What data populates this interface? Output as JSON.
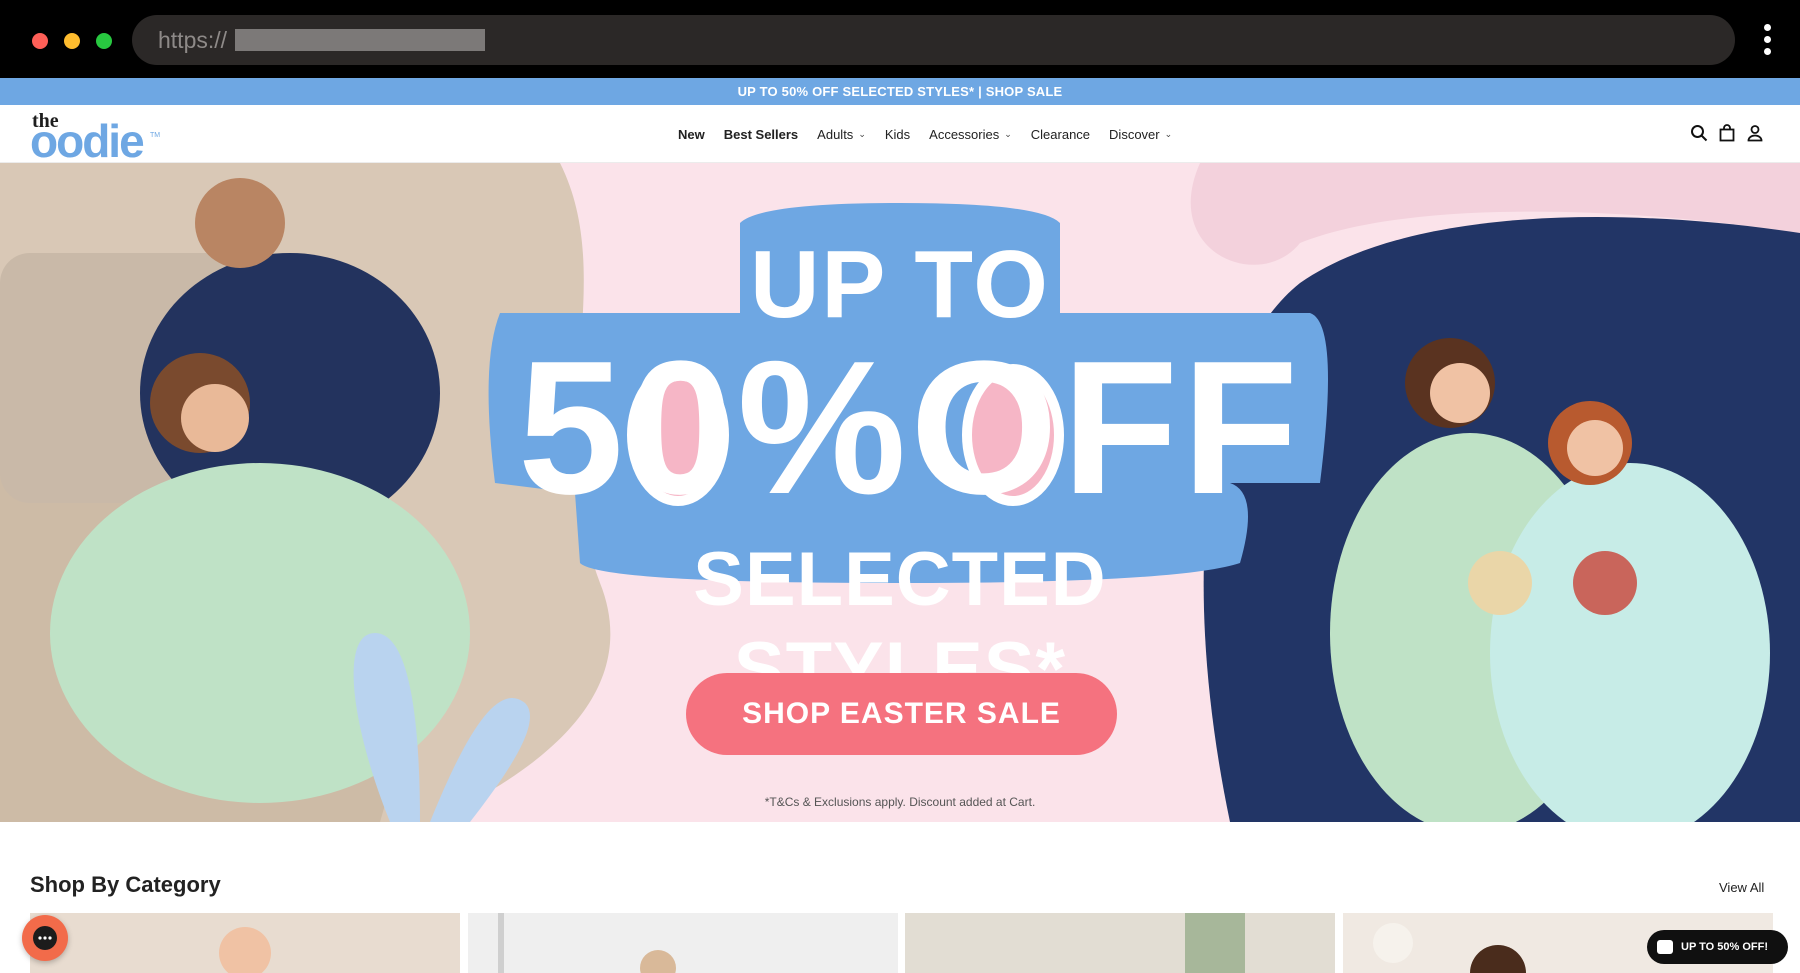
{
  "browser": {
    "url_protocol": "https://"
  },
  "announcement": {
    "text": "UP TO 50% OFF SELECTED STYLES* | SHOP SALE"
  },
  "header": {
    "logo_the": "the",
    "logo_oodie": "oodie",
    "nav": [
      {
        "label": "New",
        "bold": true
      },
      {
        "label": "Best Sellers",
        "bold": true
      },
      {
        "label": "Adults",
        "dropdown": true
      },
      {
        "label": "Kids"
      },
      {
        "label": "Accessories",
        "dropdown": true
      },
      {
        "label": "Clearance"
      },
      {
        "label": "Discover",
        "dropdown": true
      }
    ],
    "icons": [
      "search-icon",
      "cart-icon",
      "account-icon"
    ]
  },
  "hero": {
    "line1": "UP TO",
    "line2": "50%OFF",
    "line3": "SELECTED STYLES*",
    "cta": "SHOP EASTER SALE",
    "terms": "*T&Cs & Exclusions apply. Discount added at Cart.",
    "colors": {
      "background": "#fbe3ea",
      "accent_blue": "#6ea7e3",
      "cta": "#f5727f"
    }
  },
  "category": {
    "title": "Shop By Category",
    "view_all": "View All"
  },
  "floating": {
    "promo_pill": "UP TO 50% OFF!"
  }
}
